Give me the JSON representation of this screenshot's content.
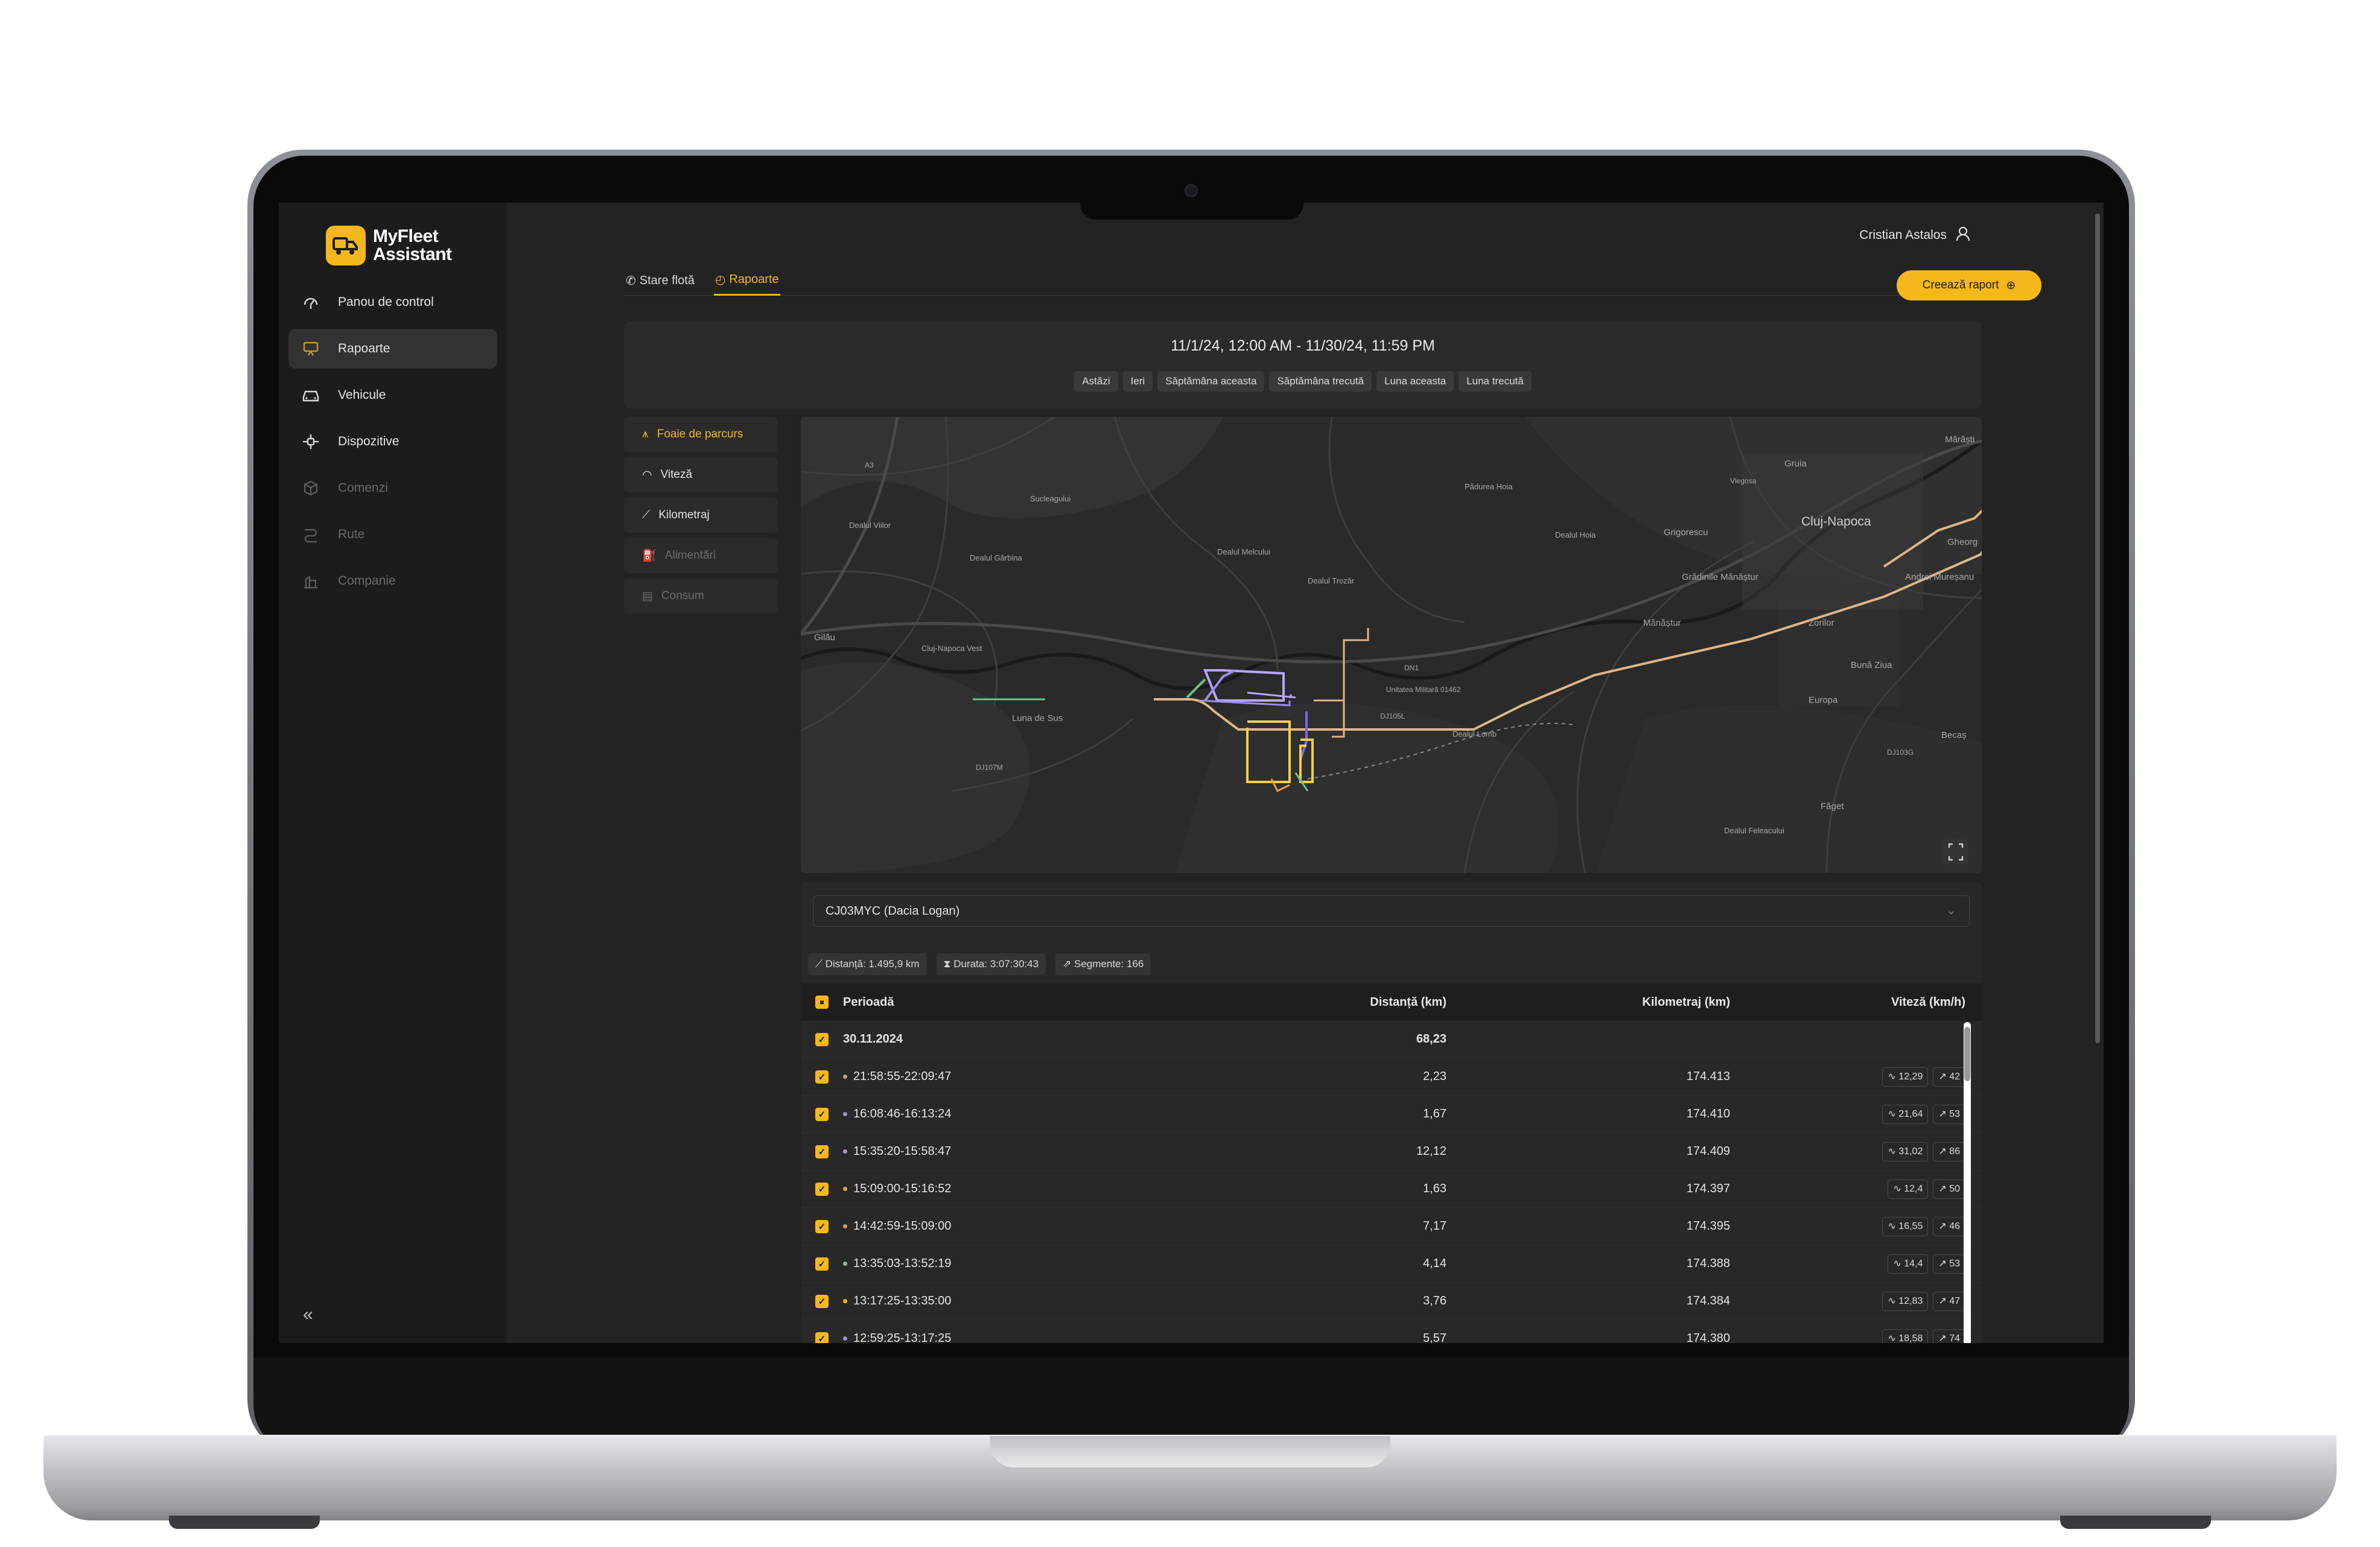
{
  "app": {
    "brand_line1": "MyFleet",
    "brand_line2": "Assistant",
    "user_name": "Cristian Astalos",
    "accent": "#f5b81c"
  },
  "sidebar": {
    "items": [
      {
        "label": "Panou de control",
        "icon": "dashboard-icon",
        "state": "normal"
      },
      {
        "label": "Rapoarte",
        "icon": "report-icon",
        "state": "active"
      },
      {
        "label": "Vehicule",
        "icon": "car-icon",
        "state": "normal"
      },
      {
        "label": "Dispozitive",
        "icon": "device-icon",
        "state": "normal"
      },
      {
        "label": "Comenzi",
        "icon": "box-icon",
        "state": "disabled"
      },
      {
        "label": "Rute",
        "icon": "route-icon",
        "state": "disabled"
      },
      {
        "label": "Companie",
        "icon": "building-icon",
        "state": "disabled"
      }
    ]
  },
  "tabs": [
    {
      "label": "Stare flotă",
      "active": false
    },
    {
      "label": "Rapoarte",
      "active": true
    }
  ],
  "create_button": "Creează raport",
  "date": {
    "range": "11/1/24, 12:00 AM - 11/30/24, 11:59 PM",
    "quick": [
      "Astăzi",
      "Ieri",
      "Săptămâna aceasta",
      "Săptămâna trecută",
      "Luna aceasta",
      "Luna trecută"
    ]
  },
  "report_types": [
    {
      "label": "Foaie de parcurs",
      "state": "active"
    },
    {
      "label": "Viteză",
      "state": "normal"
    },
    {
      "label": "Kilometraj",
      "state": "normal"
    },
    {
      "label": "Alimentări",
      "state": "disabled"
    },
    {
      "label": "Consum",
      "state": "disabled"
    }
  ],
  "map": {
    "labels": [
      "Cluj-Napoca",
      "Grigorescu",
      "Grădinile Mănăștur",
      "Mănăștur",
      "Zorilor",
      "Bună Ziua",
      "Europa",
      "Becaș",
      "Andrei Mureșanu",
      "Gheorg",
      "Mărăști",
      "Gruia",
      "Făget",
      "Luna de Sus",
      "Gilău",
      "Dealul Melcului",
      "Dealul Gârbina",
      "Dealul Viilor",
      "Dealul Trozăr",
      "Dealul Hoia",
      "Dealul Lomb",
      "Dealul Feleacului",
      "Pădurea Hoia",
      "Sucleagului",
      "Cluj-Napoca Vest",
      "Unitatea Militară 01462",
      "DJ107M",
      "DJ103G",
      "DN1",
      "DJ105L",
      "A3",
      "Vlegosa"
    ]
  },
  "vehicle": "CJ03MYC (Dacia Logan)",
  "stats": {
    "distance": "Distanță: 1.495,9 km",
    "duration": "Durata: 3:07:30:43",
    "segments": "Segmente: 166"
  },
  "table": {
    "headers": {
      "period": "Perioadă",
      "distance": "Distanță (km)",
      "odometer": "Kilometraj (km)",
      "speed": "Viteză (km/h)"
    },
    "group": {
      "date": "30.11.2024",
      "distance": "68,23"
    },
    "rows": [
      {
        "period": "21:58:55-22:09:47",
        "distance": "2,23",
        "odometer": "174.413",
        "avg": "12,29",
        "max": "42",
        "color": "#c9a06a"
      },
      {
        "period": "16:08:46-16:13:24",
        "distance": "1,67",
        "odometer": "174.410",
        "avg": "21,64",
        "max": "53",
        "color": "#9a8fe0"
      },
      {
        "period": "15:35:20-15:58:47",
        "distance": "12,12",
        "odometer": "174.409",
        "avg": "31,02",
        "max": "86",
        "color": "#b190e8"
      },
      {
        "period": "15:09:00-15:16:52",
        "distance": "1,63",
        "odometer": "174.397",
        "avg": "12,4",
        "max": "50",
        "color": "#e0a060"
      },
      {
        "period": "14:42:59-15:09:00",
        "distance": "7,17",
        "odometer": "174.395",
        "avg": "16,55",
        "max": "46",
        "color": "#e89a4a"
      },
      {
        "period": "13:35:03-13:52:19",
        "distance": "4,14",
        "odometer": "174.388",
        "avg": "14,4",
        "max": "53",
        "color": "#7fc98e"
      },
      {
        "period": "13:17:25-13:35:00",
        "distance": "3,76",
        "odometer": "174.384",
        "avg": "12,83",
        "max": "47",
        "color": "#f5b81c"
      },
      {
        "period": "12:59:25-13:17:25",
        "distance": "5,57",
        "odometer": "174.380",
        "avg": "18,58",
        "max": "74",
        "color": "#9a8fe0"
      }
    ]
  }
}
